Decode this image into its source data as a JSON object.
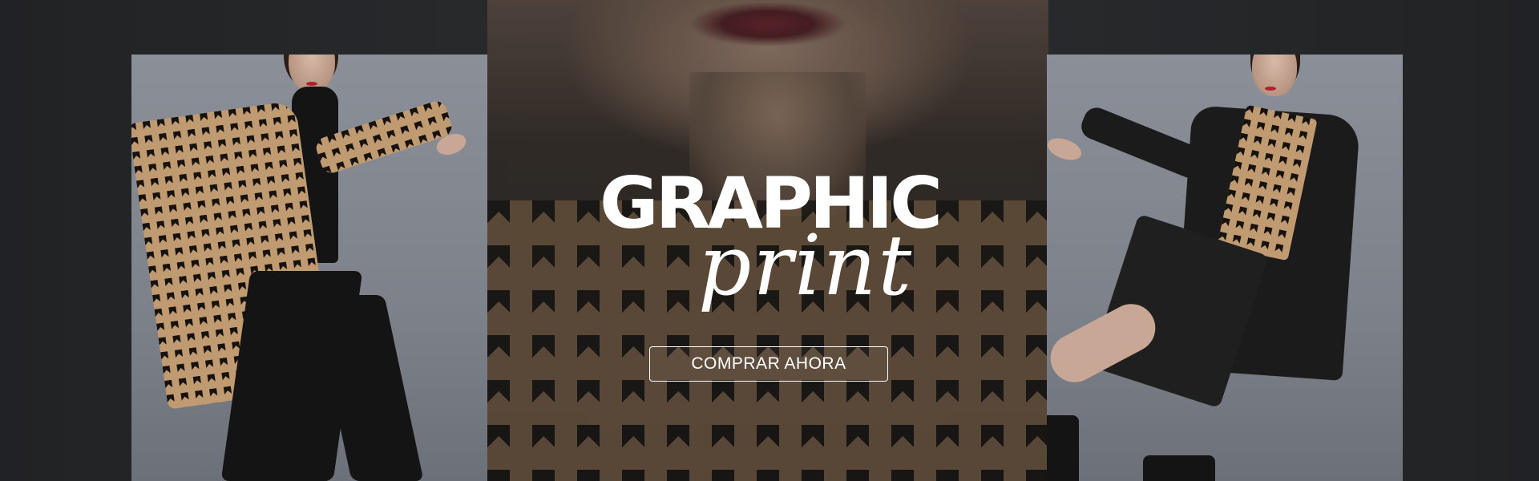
{
  "banner": {
    "title": "GRAPHIC",
    "subtitle": "print",
    "cta_label": "COMPRAR AHORA"
  },
  "colors": {
    "background": "#2a2c2f",
    "panel": "#858992",
    "pattern_light": "#c09a70",
    "pattern_dark": "#17120e",
    "text": "#ffffff"
  }
}
